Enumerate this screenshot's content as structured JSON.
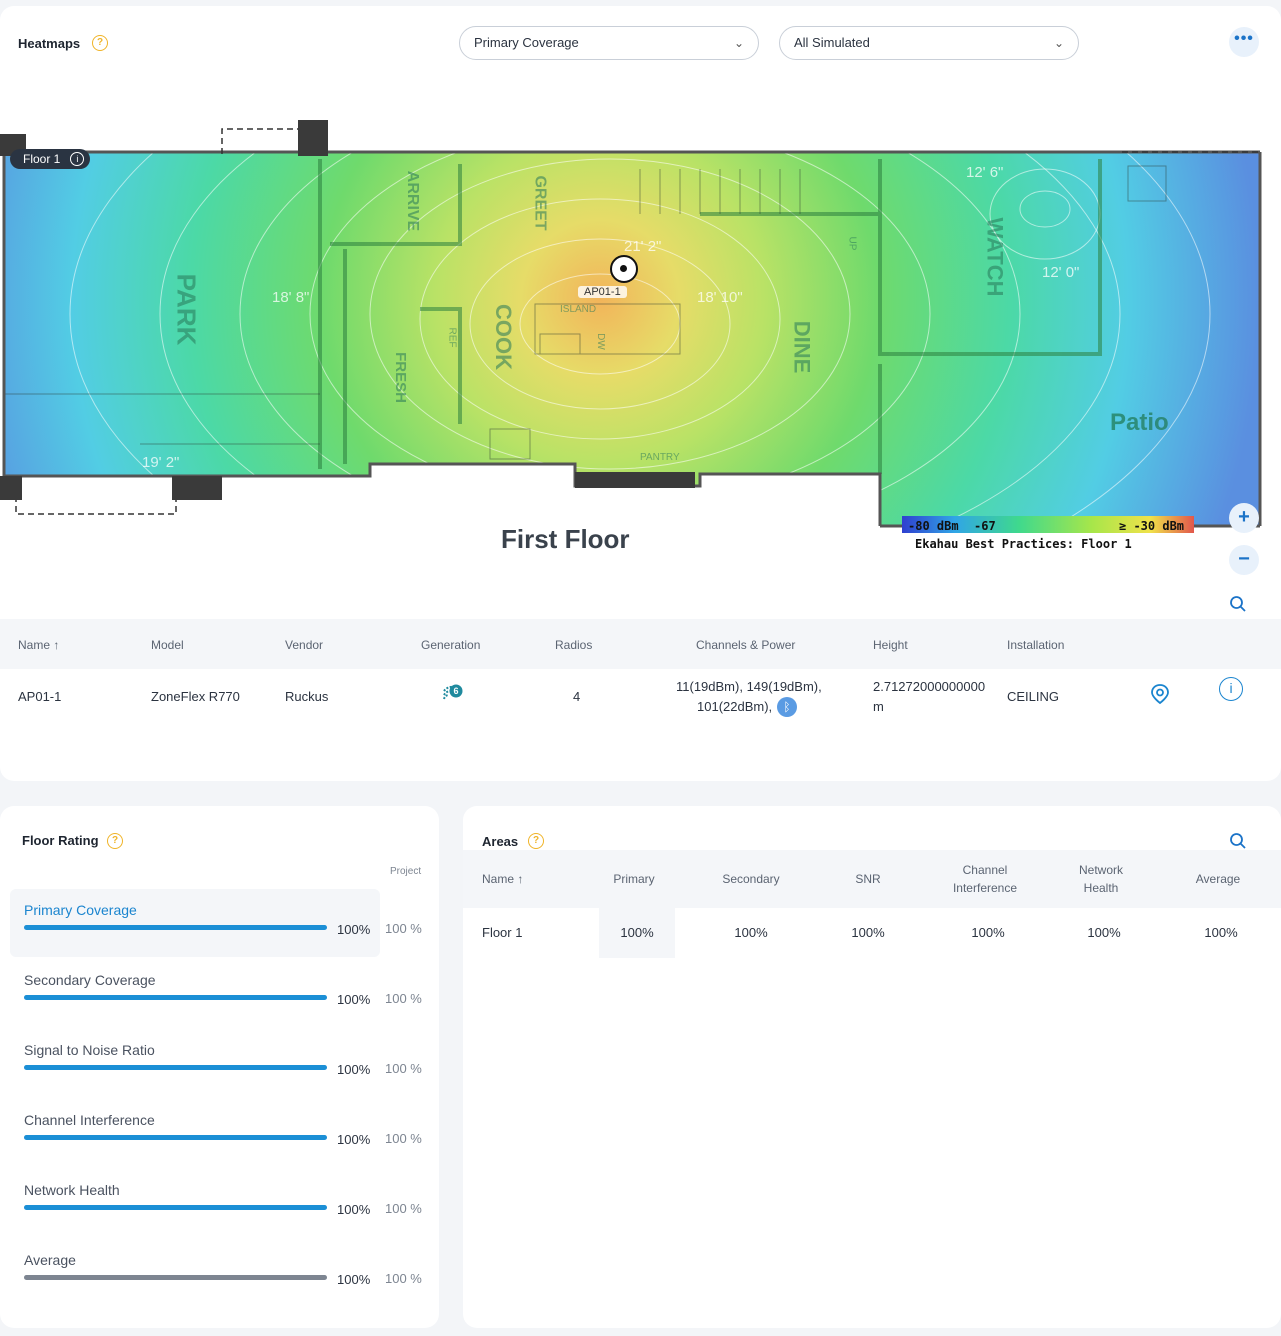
{
  "heatmaps": {
    "title": "Heatmaps",
    "help_icon": "question-icon",
    "select_visualization": "Primary Coverage",
    "select_scope": "All Simulated",
    "more_icon": "more-dots-icon"
  },
  "map": {
    "floor_badge": "Floor 1",
    "floor_title": "First Floor",
    "ap_label": "AP01-1",
    "legend_min": "-80 dBm",
    "legend_mid": "-67",
    "legend_max": "≥ -30 dBm",
    "legend_caption": "Ekahau Best Practices: Floor 1",
    "room_labels": [
      "PARK",
      "ARRIVE",
      "GREET",
      "COOK",
      "FRESH",
      "DINE",
      "WATCH",
      "Patio",
      "ISLAND",
      "REF",
      "PANTRY",
      "DW",
      "UP"
    ],
    "dimension_labels": [
      "18' 8\"",
      "21' 2\"",
      "18' 10\"",
      "12' 0\"",
      "12' 6\"",
      "19' 2\""
    ],
    "zoom_in": "+",
    "zoom_out": "−"
  },
  "ap_table": {
    "headers": [
      "Name ↑",
      "Model",
      "Vendor",
      "Generation",
      "Radios",
      "Channels & Power",
      "Height",
      "Installation"
    ],
    "rows": [
      {
        "name": "AP01-1",
        "model": "ZoneFlex R770",
        "vendor": "Ruckus",
        "generation_icon": "wifi-6-icon",
        "radios": "4",
        "channels_line1": "11(19dBm), 149(19dBm),",
        "channels_line2": "101(22dBm),",
        "height_line1": "2.71272000000000",
        "height_line2": "m",
        "installation": "CEILING"
      }
    ]
  },
  "floor_rating": {
    "title": "Floor Rating",
    "project_label": "Project",
    "items": [
      {
        "label": "Primary Coverage",
        "value": "100%",
        "project": "100 %",
        "fill": 1.0
      },
      {
        "label": "Secondary Coverage",
        "value": "100%",
        "project": "100 %",
        "fill": 1.0
      },
      {
        "label": "Signal to Noise Ratio",
        "value": "100%",
        "project": "100 %",
        "fill": 1.0
      },
      {
        "label": "Channel Interference",
        "value": "100%",
        "project": "100 %",
        "fill": 1.0
      },
      {
        "label": "Network Health",
        "value": "100%",
        "project": "100 %",
        "fill": 1.0
      },
      {
        "label": "Average",
        "value": "100%",
        "project": "100 %",
        "fill": 1.0
      }
    ]
  },
  "areas": {
    "title": "Areas",
    "headers": {
      "name": "Name ↑",
      "primary": "Primary",
      "secondary": "Secondary",
      "snr": "SNR",
      "channel_1": "Channel",
      "channel_2": "Interference",
      "network_1": "Network",
      "network_2": "Health",
      "average": "Average"
    },
    "rows": [
      {
        "name": "Floor 1",
        "primary": "100%",
        "secondary": "100%",
        "snr": "100%",
        "channel": "100%",
        "network": "100%",
        "average": "100%"
      }
    ]
  }
}
